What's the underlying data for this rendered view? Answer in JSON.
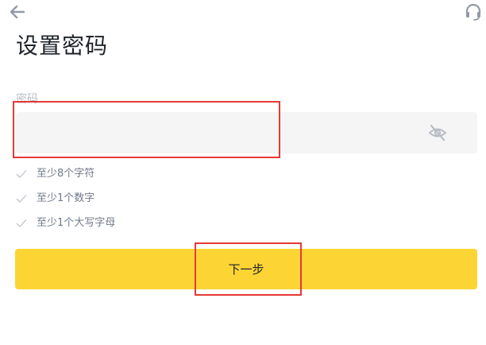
{
  "header": {
    "back_icon": "arrow-left-icon",
    "support_icon": "headset-icon"
  },
  "title": "设置密码",
  "password_field": {
    "label": "密码",
    "value": "",
    "placeholder": "",
    "toggle_icon": "eye-slash-icon"
  },
  "requirements": [
    {
      "label": "至少8个字符",
      "met": false
    },
    {
      "label": "至少1个数字",
      "met": false
    },
    {
      "label": "至少1个大写字母",
      "met": false
    }
  ],
  "next_button": {
    "label": "下一步"
  },
  "colors": {
    "accent": "#fcd535",
    "highlight": "#e53935",
    "input_bg": "#f5f5f5",
    "muted_text": "#707a8a"
  }
}
